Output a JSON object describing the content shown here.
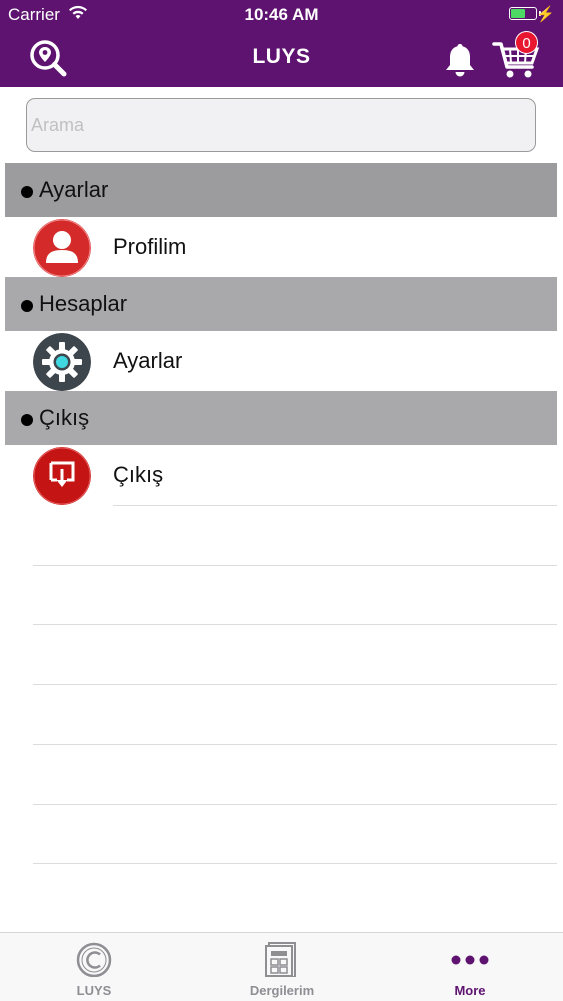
{
  "status_bar": {
    "carrier": "Carrier",
    "time": "10:46 AM"
  },
  "nav": {
    "title": "LUYS",
    "cart_count": "0"
  },
  "search": {
    "placeholder": "Arama",
    "value": ""
  },
  "menu": {
    "sections": [
      {
        "header": "Ayarlar",
        "item": "Profilim",
        "icon": "user-icon",
        "color": "#d52a2a"
      },
      {
        "header": "Hesaplar",
        "item": "Ayarlar",
        "icon": "gear-icon",
        "color": "#3e464d"
      },
      {
        "header": "Çıkış",
        "item": "Çıkış",
        "icon": "logout-icon",
        "color": "#c51414"
      }
    ]
  },
  "tabs": [
    {
      "label": "LUYS",
      "icon": "copyright-icon",
      "active": false
    },
    {
      "label": "Dergilerim",
      "icon": "magazine-icon",
      "active": false
    },
    {
      "label": "More",
      "icon": "more-icon",
      "active": true
    }
  ],
  "colors": {
    "brand": "#5e1370",
    "badge": "#e8162e",
    "section_bg": "#a9a9ab",
    "inactive_tab": "#8e8e93"
  }
}
